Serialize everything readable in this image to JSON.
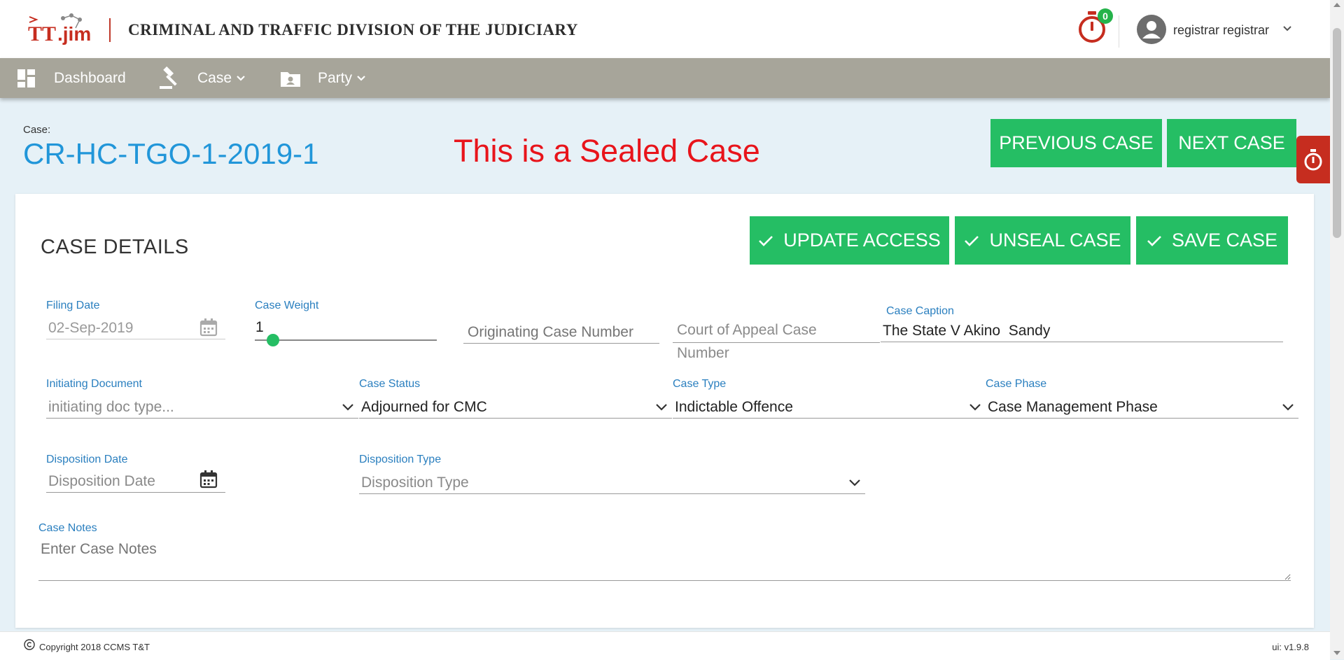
{
  "header": {
    "logo_text": "TT.jim",
    "org_title": "CRIMINAL AND TRAFFIC DIVISION OF THE JUDICIARY",
    "timer_badge": "0",
    "user_name": "registrar registrar"
  },
  "nav": {
    "dashboard": "Dashboard",
    "case": "Case",
    "party": "Party"
  },
  "case_header": {
    "label": "Case:",
    "number": "CR-HC-TGO-1-2019-1",
    "sealed_notice": "This is a Sealed Case",
    "prev_button": "PREVIOUS CASE",
    "next_button": "NEXT CASE"
  },
  "details": {
    "title": "CASE DETAILS",
    "update_access": "UPDATE ACCESS",
    "unseal_case": "UNSEAL CASE",
    "save_case": "SAVE CASE",
    "filing_date": {
      "label": "Filing Date",
      "value": "02-Sep-2019"
    },
    "case_weight": {
      "label": "Case Weight",
      "value": "1",
      "slider_level": 0.1
    },
    "originating_case_number": {
      "placeholder": "Originating Case Number"
    },
    "court_of_appeal": {
      "placeholder_line1": "Court of Appeal Case",
      "placeholder_line2": "Number"
    },
    "case_caption": {
      "label": "Case Caption",
      "value": "The State V Akino  Sandy"
    },
    "initiating_document": {
      "label": "Initiating Document",
      "value": "initiating doc type..."
    },
    "case_status": {
      "label": "Case Status",
      "value": "Adjourned for CMC"
    },
    "case_type": {
      "label": "Case Type",
      "value": "Indictable Offence"
    },
    "case_phase": {
      "label": "Case Phase",
      "value": "Case Management Phase"
    },
    "disposition_date": {
      "label": "Disposition Date",
      "placeholder": "Disposition Date"
    },
    "disposition_type": {
      "label": "Disposition Type",
      "placeholder": "Disposition Type"
    },
    "case_notes": {
      "label": "Case Notes",
      "placeholder": "Enter Case Notes"
    }
  },
  "footer": {
    "copyright": "Copyright 2018  CCMS T&T",
    "version": "ui: v1.9.8"
  },
  "colors": {
    "accent_blue": "#2196d9",
    "button_green": "#25be64",
    "sealed_red": "#e8141b",
    "nav_bg": "#a7a59a"
  }
}
